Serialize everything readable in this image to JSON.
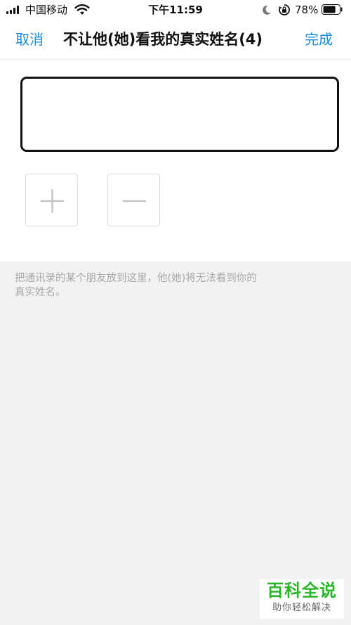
{
  "status_bar": {
    "carrier": "中国移动",
    "time": "下午11:59",
    "battery_percent": "78%",
    "battery_level": 0.78
  },
  "nav": {
    "cancel_label": "取消",
    "title": "不让他(她)看我的真实姓名(4)",
    "done_label": "完成",
    "accent_color": "#1a8ce0"
  },
  "actions": {
    "add_icon": "plus-icon",
    "remove_icon": "minus-icon"
  },
  "hint": {
    "line1": "把通讯录的某个朋友放到这里，他(她)将无法看到你的",
    "line2": "真实姓名。"
  },
  "watermark": {
    "title": "百科全说",
    "subtitle": "助你轻松解决"
  }
}
